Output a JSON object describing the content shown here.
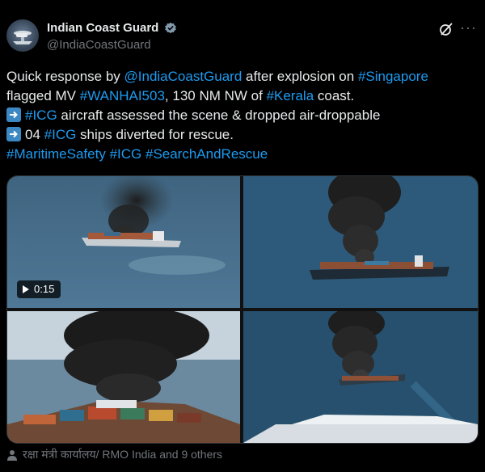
{
  "author": {
    "name": "Indian Coast Guard",
    "handle": "@IndiaCoastGuard",
    "avatar_icon": "coast-guard-logo-icon",
    "verified_icon": "verified-badge-icon",
    "verified_color": "#829aab"
  },
  "actions": {
    "grok_icon": "grok-icon",
    "more_icon": "more-options-icon",
    "more_label": "···"
  },
  "tweet": {
    "line1_a": "Quick response by ",
    "line1_mention": "@IndiaCoastGuard",
    "line1_b": " after explosion on ",
    "line1_tag": "#Singapore",
    "line2_a": "flagged MV ",
    "line2_tag": "#WANHAI503",
    "line2_b": ", 130 NM NW of ",
    "line2_tag2": "#Kerala",
    "line2_c": " coast.",
    "line3_tag": "#ICG",
    "line3_b": " aircraft assessed the scene & dropped air-droppable",
    "line4_a": "04 ",
    "line4_tag": "#ICG",
    "line4_b": " ships diverted for rescue.",
    "line5_tag1": "#MaritimeSafety",
    "line5_tag2": "#ICG",
    "line5_tag3": "#SearchAndRescue",
    "arrow_icon": "right-arrow-emoji-icon",
    "link_color": "#1d9bf0"
  },
  "media": {
    "video_duration": "0:15",
    "images": [
      {
        "icon": "burning-ship-aerial-video"
      },
      {
        "icon": "burning-ship-smoke-plume"
      },
      {
        "icon": "burning-ship-deck-closeup"
      },
      {
        "icon": "burning-ship-from-aircraft"
      }
    ]
  },
  "tagged": {
    "icon": "person-icon",
    "text": "रक्षा मंत्री कार्यालय/ RMO India and 9 others"
  }
}
